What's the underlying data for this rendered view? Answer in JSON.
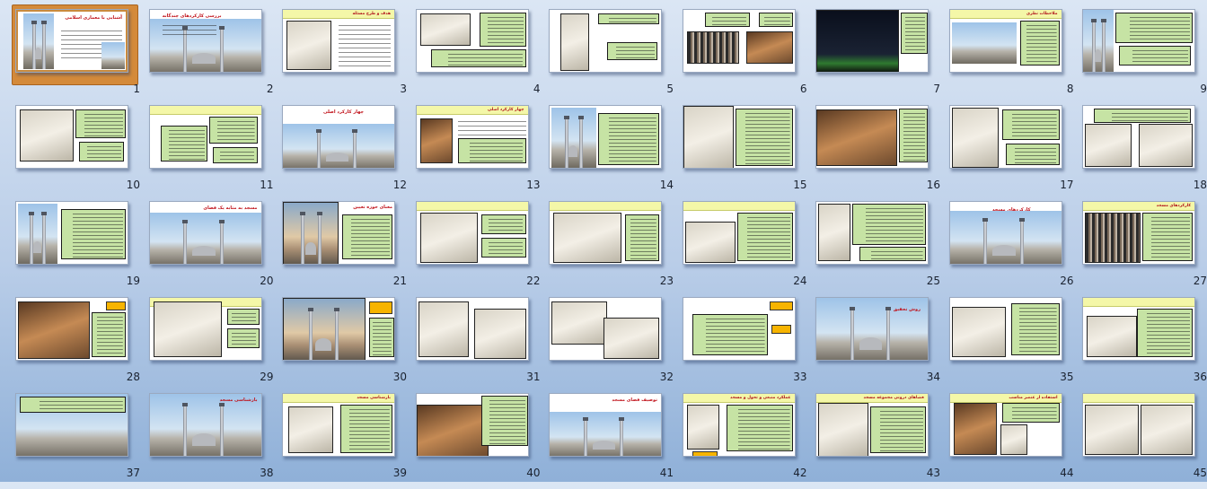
{
  "window": {
    "view": "Slide Sorter"
  },
  "slides": [
    {
      "n": "1",
      "title": "آشنایی با معماری اسلامی"
    },
    {
      "n": "2",
      "title": "بررسی کارکردهای چندگانه"
    },
    {
      "n": "3",
      "title": "هدف و طرح مسئله"
    },
    {
      "n": "4",
      "title": ""
    },
    {
      "n": "5",
      "title": ""
    },
    {
      "n": "6",
      "title": ""
    },
    {
      "n": "7",
      "title": ""
    },
    {
      "n": "8",
      "title": "ملاحظات نظری"
    },
    {
      "n": "9",
      "title": ""
    },
    {
      "n": "10",
      "title": ""
    },
    {
      "n": "11",
      "title": ""
    },
    {
      "n": "12",
      "title": "چهار کارکرد اصلی"
    },
    {
      "n": "13",
      "title": "چهار کارکرد اصلی"
    },
    {
      "n": "14",
      "title": ""
    },
    {
      "n": "15",
      "title": ""
    },
    {
      "n": "16",
      "title": ""
    },
    {
      "n": "17",
      "title": ""
    },
    {
      "n": "18",
      "title": ""
    },
    {
      "n": "19",
      "title": ""
    },
    {
      "n": "20",
      "title": "مسجد به مثابه یک فضای"
    },
    {
      "n": "21",
      "title": "معنای حوزه تعیین"
    },
    {
      "n": "22",
      "title": ""
    },
    {
      "n": "23",
      "title": ""
    },
    {
      "n": "24",
      "title": ""
    },
    {
      "n": "25",
      "title": ""
    },
    {
      "n": "26",
      "title": "کارکردهای مسجد"
    },
    {
      "n": "27",
      "title": "کارکردهای مسجد"
    },
    {
      "n": "28",
      "title": ""
    },
    {
      "n": "29",
      "title": ""
    },
    {
      "n": "30",
      "title": ""
    },
    {
      "n": "31",
      "title": ""
    },
    {
      "n": "32",
      "title": ""
    },
    {
      "n": "33",
      "title": ""
    },
    {
      "n": "34",
      "title": "روش تحقیق"
    },
    {
      "n": "35",
      "title": ""
    },
    {
      "n": "36",
      "title": ""
    },
    {
      "n": "37",
      "title": ""
    },
    {
      "n": "38",
      "title": "بازشناسی مسجد"
    },
    {
      "n": "39",
      "title": "بازشناسی مسجد"
    },
    {
      "n": "40",
      "title": ""
    },
    {
      "n": "41",
      "title": "توصیف فضای مسجد"
    },
    {
      "n": "42",
      "title": "عملکرد منبعی و تحول و مسجد"
    },
    {
      "n": "43",
      "title": "فضاهای درونی مجموعه مسجد"
    },
    {
      "n": "44",
      "title": "استفاده از عنصر مناسب"
    },
    {
      "n": "45",
      "title": ""
    }
  ],
  "selected_slide": "1"
}
